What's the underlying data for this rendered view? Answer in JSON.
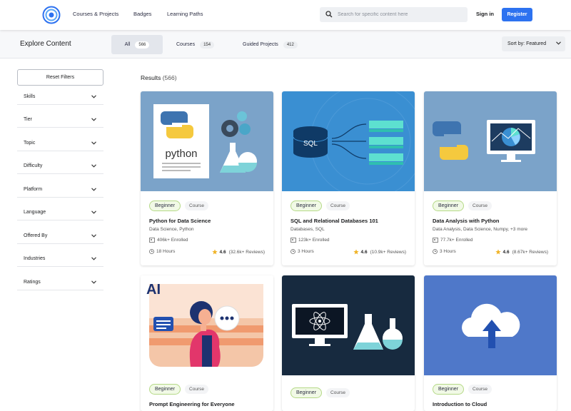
{
  "nav": {
    "links": [
      "Courses & Projects",
      "Badges",
      "Learning Paths"
    ],
    "search_placeholder": "Search for specific content here",
    "signin": "Sign in",
    "register": "Register",
    "brand_color": "#2d72f0"
  },
  "subbar": {
    "title": "Explore Content",
    "tabs": [
      {
        "label": "All",
        "count": "566"
      },
      {
        "label": "Courses",
        "count": "154"
      },
      {
        "label": "Guided Projects",
        "count": "412"
      }
    ],
    "sort": "Sort by: Featured"
  },
  "sidebar": {
    "reset": "Reset Filters",
    "filters": [
      "Skills",
      "Tier",
      "Topic",
      "Difficulty",
      "Platform",
      "Language",
      "Offered By",
      "Industries",
      "Ratings"
    ]
  },
  "results": {
    "label": "Results",
    "count": "(566)"
  },
  "cards": [
    {
      "level": "Beginner",
      "type": "Course",
      "title": "Python for Data Science",
      "tags": "Data Science, Python",
      "enrolled": "406k+ Enrolled",
      "hours": "18 Hours",
      "rating": "4.6",
      "reviews": "(32.6k+ Reviews)",
      "thumb": "python-book-gears-flask"
    },
    {
      "level": "Beginner",
      "type": "Course",
      "title": "SQL and Relational Databases 101",
      "tags": "Databases, SQL",
      "enrolled": "123k+ Enrolled",
      "hours": "3 Hours",
      "rating": "4.6",
      "reviews": "(10.9k+ Reviews)",
      "thumb": "sql-database-tables"
    },
    {
      "level": "Beginner",
      "type": "Course",
      "title": "Data Analysis with Python",
      "tags": "Data Analysis, Data Science, Numpy, +3 more",
      "enrolled": "77.7k+ Enrolled",
      "hours": "3 Hours",
      "rating": "4.6",
      "reviews": "(8.67k+ Reviews)",
      "thumb": "python-monitor-chart"
    },
    {
      "level": "Beginner",
      "type": "Course",
      "title": "Prompt Engineering for Everyone",
      "thumb": "ai-woman-chatbot",
      "logo_text": "AI"
    },
    {
      "level": "Beginner",
      "type": "Course",
      "title": "",
      "thumb": "monitor-atom-flasks"
    },
    {
      "level": "Beginner",
      "type": "Course",
      "title": "Introduction to Cloud",
      "thumb": "cloud-upload"
    }
  ]
}
